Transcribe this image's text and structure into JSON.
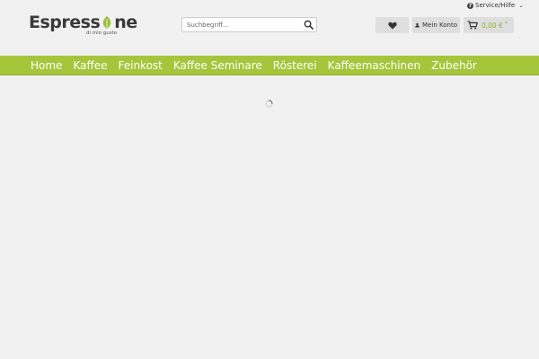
{
  "header": {
    "service_label": "Service/Hilfe",
    "logo_text_prefix": "Espress",
    "logo_text_suffix": "ne",
    "logo_subtitle": "di mio gusto",
    "search_placeholder": "Suchbegriff...",
    "account_label": "Mein Konto",
    "cart_amount": "0,00 €",
    "cart_star": "*"
  },
  "nav": {
    "items": [
      {
        "label": "Home"
      },
      {
        "label": "Kaffee"
      },
      {
        "label": "Feinkost"
      },
      {
        "label": "Kaffee Seminare"
      },
      {
        "label": "Rösterei"
      },
      {
        "label": "Kaffeemaschinen"
      },
      {
        "label": "Zubehör"
      }
    ]
  },
  "colors": {
    "accent_green": "#a5c63b",
    "price_green": "#8cb52e",
    "background": "#f1f1f1"
  },
  "icons": {
    "service": "question-circle-icon",
    "search": "magnifier-icon",
    "wishlist": "heart-icon",
    "account": "user-icon",
    "cart": "shopping-cart-icon",
    "loading": "spinner-icon"
  }
}
